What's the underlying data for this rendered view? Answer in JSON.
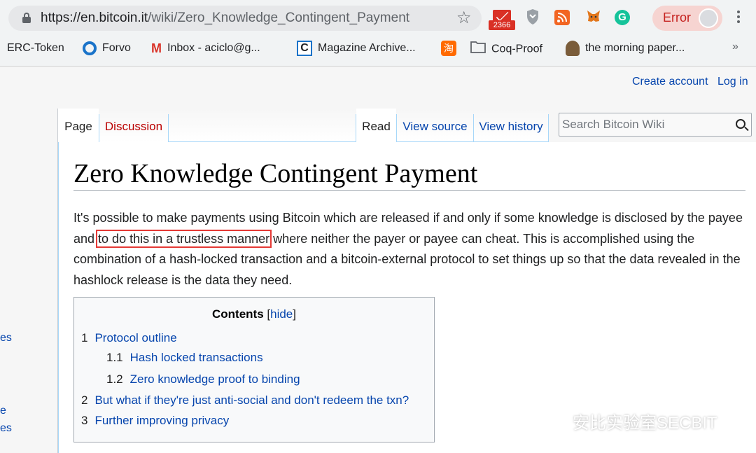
{
  "browser": {
    "url_host": "https://en.bitcoin.it",
    "url_path": "/wiki/Zero_Knowledge_Contingent_Payment",
    "gmail_count": "2366",
    "error_label": "Error",
    "bookmarks": [
      "ERC-Token",
      "Forvo",
      "Inbox - aciclo@g...",
      "Magazine Archive...",
      "Coq-Proof",
      "the morning paper..."
    ],
    "more_bookmarks": "»"
  },
  "wiki": {
    "personal": {
      "create_account": "Create account",
      "login": "Log in"
    },
    "tabs": {
      "page": "Page",
      "discussion": "Discussion",
      "read": "Read",
      "view_source": "View source",
      "view_history": "View history"
    },
    "search": {
      "placeholder": "Search Bitcoin Wiki"
    },
    "sidebar_fragments": [
      "es",
      "e",
      "es"
    ],
    "title": "Zero Knowledge Contingent Payment",
    "intro": {
      "before": "It's possible to make payments using Bitcoin which are released if and only if some knowledge is disclosed by the payee and ",
      "highlight": "to do this in a trustless manner",
      "after": " where neither the payer or payee can cheat. This is accomplished using the combination of a hash-locked transaction and a bitcoin-external protocol to set things up so that the data revealed in the hashlock release is the data they need."
    },
    "toc": {
      "title": "Contents",
      "hide_open": "[",
      "hide": "hide",
      "hide_close": "]",
      "items": [
        {
          "num": "1",
          "label": "Protocol outline"
        },
        {
          "num": "1.1",
          "label": "Hash locked transactions"
        },
        {
          "num": "1.2",
          "label": "Zero knowledge proof to binding"
        },
        {
          "num": "2",
          "label": "But what if they're just anti-social and don't redeem the txn?"
        },
        {
          "num": "3",
          "label": "Further improving privacy"
        }
      ]
    }
  },
  "watermark": "安比实验室SECBIT",
  "colors": {
    "link": "#0645ad",
    "highlight_box": "#e53935",
    "discussion": "#ba0000"
  }
}
